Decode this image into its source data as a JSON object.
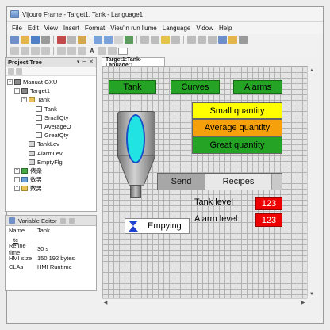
{
  "window": {
    "title": "Vijouro Frame - Target1, Tank - Language1"
  },
  "menu": [
    "File",
    "Edit",
    "View",
    "Insert",
    "Format",
    "Vieu'in run l'ume",
    "Language",
    "Vidow",
    "Help"
  ],
  "toolbar": {
    "text_tool_label": "A"
  },
  "project_tree": {
    "title": "Project Tree",
    "items": [
      {
        "label": "Manuat GXU",
        "level": 0,
        "toggle": "−",
        "icon": "comp"
      },
      {
        "label": "Target1",
        "level": 1,
        "toggle": "−",
        "icon": "comp"
      },
      {
        "label": "Tank",
        "level": 2,
        "toggle": "−",
        "icon": "folder"
      },
      {
        "label": "Tank",
        "level": 3,
        "toggle": "",
        "icon": "page"
      },
      {
        "label": "SmallQty",
        "level": 3,
        "toggle": "",
        "icon": "page"
      },
      {
        "label": "AverageO",
        "level": 3,
        "toggle": "",
        "icon": "page"
      },
      {
        "label": "GreatQty",
        "level": 3,
        "toggle": "",
        "icon": "page"
      },
      {
        "label": "TankLev",
        "level": 2,
        "toggle": "",
        "icon": "tag"
      },
      {
        "label": "AlarmLev",
        "level": 2,
        "toggle": "",
        "icon": "tag"
      },
      {
        "label": "EmptyFlg",
        "level": 2,
        "toggle": "",
        "icon": "tag"
      },
      {
        "label": "俵衆",
        "level": 1,
        "toggle": "+",
        "icon": "green"
      },
      {
        "label": "数男",
        "level": 1,
        "toggle": "+",
        "icon": "mix"
      },
      {
        "label": "数男",
        "level": 1,
        "toggle": "+",
        "icon": "folder"
      }
    ]
  },
  "variable_editor": {
    "title": "Variable Editor",
    "rows": [
      {
        "label": "Name",
        "value": "Tank"
      },
      {
        "label": "tc",
        "value": ""
      },
      {
        "label": "Refine time",
        "value": "30 s"
      },
      {
        "label": "HMI size",
        "value": "150,192 bytes"
      },
      {
        "label": "CLAs",
        "value": "HMI Runtime"
      }
    ]
  },
  "editor_tab": {
    "label": "Target1:Tank-Lanuage:1"
  },
  "screen": {
    "nav_buttons": {
      "tank": "Tank",
      "curves": "Curves",
      "alarms": "Alarms"
    },
    "quantity": {
      "small": "Small quantity",
      "average": "Average quantity",
      "great": "Great quantity"
    },
    "send_label": "Send",
    "recipes_label": "Recipes",
    "tank_level_label": "Tank level",
    "tank_level_value": "123",
    "alarm_level_label": "Alarm level:",
    "alarm_level_value": "123",
    "empty_label": "Empying"
  },
  "colors": {
    "nav_green": "#24a324",
    "small_yellow": "#ffff00",
    "average_orange": "#f6a10c",
    "great_green": "#24a324",
    "value_red": "#e00000",
    "glass_cyan": "#22e3e3",
    "hourglass_blue": "#1f3fcf"
  }
}
